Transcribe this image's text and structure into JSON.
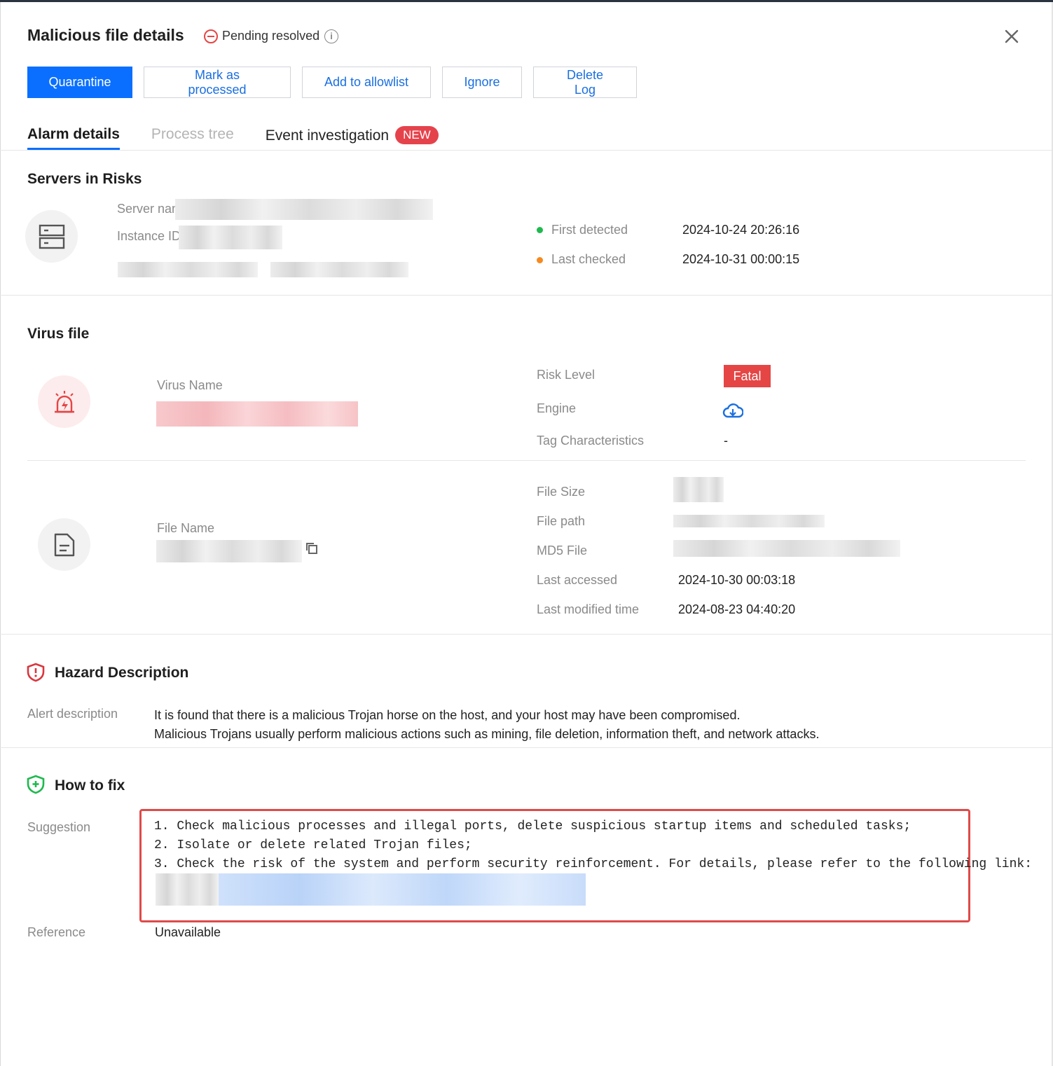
{
  "header": {
    "title": "Malicious file details",
    "status": "Pending resolved"
  },
  "actions": {
    "quarantine": "Quarantine",
    "mark_processed": "Mark as processed",
    "add_allowlist": "Add to allowlist",
    "ignore": "Ignore",
    "delete_log": "Delete Log"
  },
  "tabs": {
    "alarm_details": "Alarm details",
    "process_tree": "Process tree",
    "event_investigation": "Event investigation",
    "new_badge": "NEW"
  },
  "servers": {
    "title": "Servers in Risks",
    "server_name_label": "Server nam",
    "instance_id_label": "Instance ID",
    "first_detected_label": "First detected",
    "first_detected_value": "2024-10-24 20:26:16",
    "last_checked_label": "Last checked",
    "last_checked_value": "2024-10-31 00:00:15"
  },
  "virus": {
    "title": "Virus file",
    "virus_name_label": "Virus Name",
    "risk_level_label": "Risk Level",
    "risk_level_value": "Fatal",
    "engine_label": "Engine",
    "tag_label": "Tag Characteristics",
    "tag_value": "-",
    "file_name_label": "File Name",
    "file_size_label": "File Size",
    "file_path_label": "File path",
    "md5_label": "MD5 File",
    "last_accessed_label": "Last accessed",
    "last_accessed_value": "2024-10-30 00:03:18",
    "last_modified_label": "Last modified time",
    "last_modified_value": "2024-08-23 04:40:20"
  },
  "hazard": {
    "title": "Hazard Description",
    "alert_label": "Alert description",
    "line1": "It is found that there is a malicious Trojan horse on the host, and your host may have been compromised.",
    "line2": "Malicious Trojans usually perform malicious actions such as mining, file deletion, information theft, and network attacks."
  },
  "fix": {
    "title": "How to fix",
    "suggestion_label": "Suggestion",
    "line1": "1. Check malicious processes and illegal ports, delete suspicious startup items and scheduled tasks;",
    "line2": "2. Isolate or delete related Trojan files;",
    "line3": "3. Check the risk of the system and perform security reinforcement. For details, please refer to the following link:",
    "reference_label": "Reference",
    "reference_value": "Unavailable"
  },
  "colors": {
    "primary": "#0a6fff",
    "danger": "#e54545",
    "success": "#1fb94f",
    "warning": "#f58a1f"
  },
  "icons": {
    "status": "minus-circle-icon",
    "info": "info-icon",
    "close": "close-icon",
    "server": "server-icon",
    "alarm": "alarm-icon",
    "engine": "cloud-download-icon",
    "file": "file-icon",
    "copy": "copy-icon",
    "hazard": "shield-alert-icon",
    "fix": "shield-plus-icon"
  }
}
